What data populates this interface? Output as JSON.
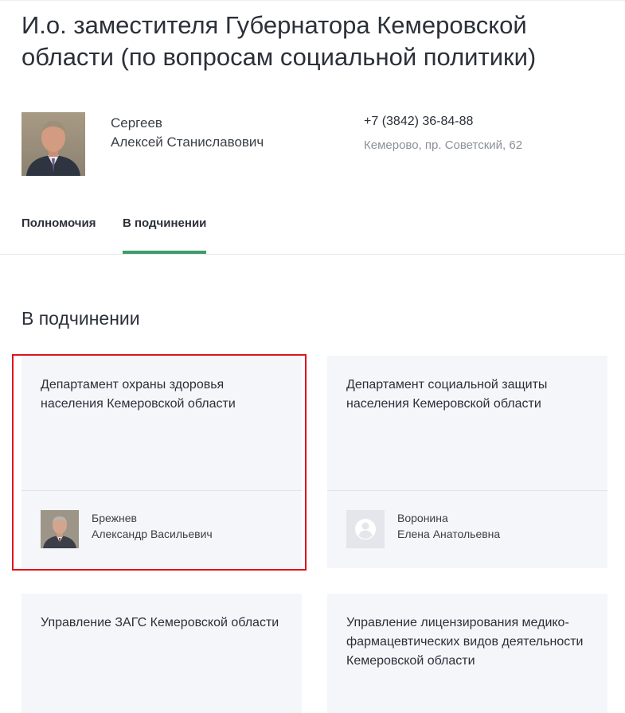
{
  "header": {
    "title": "И.о. заместителя Губернатора Кемеровской области (по вопросам социальной политики)"
  },
  "person": {
    "last_name": "Сергеев",
    "first_middle": "Алексей Станиславович",
    "phone": "+7 (3842) 36-84-88",
    "address": "Кемерово, пр. Советский, 62"
  },
  "tabs": [
    {
      "label": "Полномочия",
      "active": false
    },
    {
      "label": "В подчинении",
      "active": true
    }
  ],
  "section": {
    "title": "В подчинении"
  },
  "departments": [
    {
      "title": "Департамент охраны здоровья населения Кемеровской области",
      "head_last": "Брежнев",
      "head_first_middle": "Александр Васильевич",
      "has_photo": true,
      "highlighted": true
    },
    {
      "title": "Департамент социальной защиты населения Кемеровской области",
      "head_last": "Воронина",
      "head_first_middle": "Елена Анатольевна",
      "has_photo": false,
      "highlighted": false
    },
    {
      "title": "Управление ЗАГС Кемеровской области",
      "head_last": "",
      "head_first_middle": "",
      "has_photo": false,
      "highlighted": false
    },
    {
      "title": "Управление лицензирования медико-фармацевтических видов деятельности Кемеровской области",
      "head_last": "",
      "head_first_middle": "",
      "has_photo": false,
      "highlighted": false
    }
  ],
  "colors": {
    "accent": "#3d9c68",
    "highlight": "#e0131b",
    "card_bg": "#f4f6fa"
  }
}
